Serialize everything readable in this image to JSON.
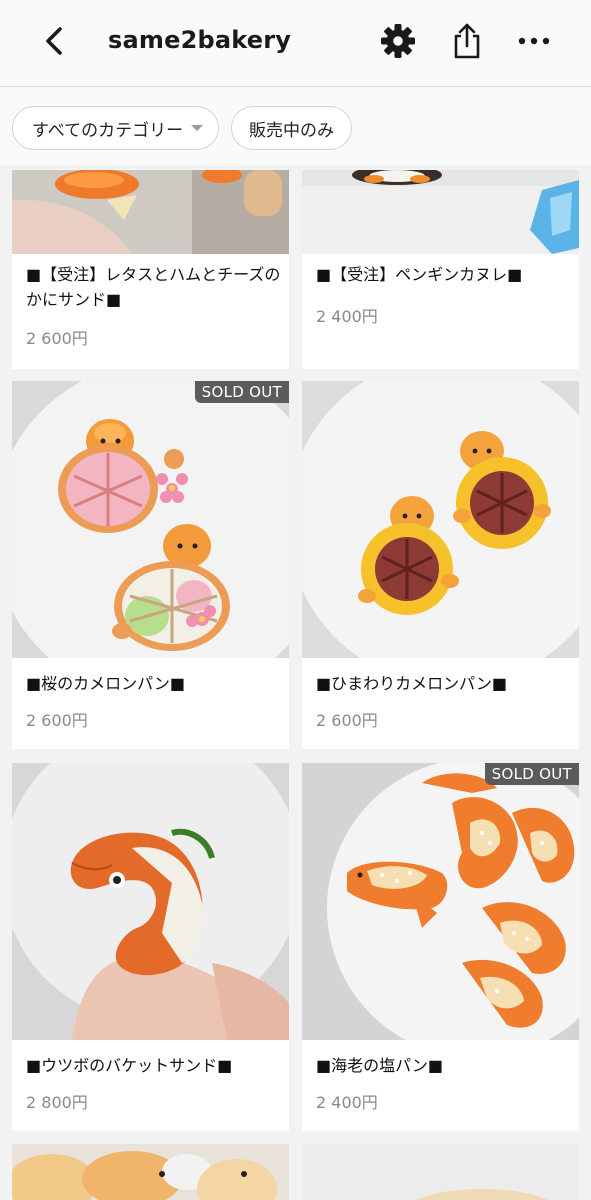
{
  "header": {
    "title": "same2bakery",
    "back_icon": "chevron-left-icon",
    "settings_icon": "gear-icon",
    "share_icon": "share-icon",
    "more_icon": "more-dots-icon"
  },
  "filters": {
    "category_label": "すべてのカテゴリー",
    "on_sale_label": "販売中のみ"
  },
  "products": [
    {
      "name": "■【受注】レタスとハムとチーズのかにサンド■",
      "price": "2 600円",
      "sold_out": false
    },
    {
      "name": "■【受注】ペンギンカヌレ■",
      "price": "2 400円",
      "sold_out": false
    },
    {
      "name": "■桜のカメロンパン■",
      "price": "2 600円",
      "sold_out": true
    },
    {
      "name": "■ひまわりカメロンパン■",
      "price": "2 600円",
      "sold_out": false
    },
    {
      "name": "■ウツボのバケットサンド■",
      "price": "2 800円",
      "sold_out": false
    },
    {
      "name": "■海老の塩パン■",
      "price": "2 400円",
      "sold_out": true
    }
  ],
  "badges": {
    "sold_out": "SOLD OUT"
  }
}
